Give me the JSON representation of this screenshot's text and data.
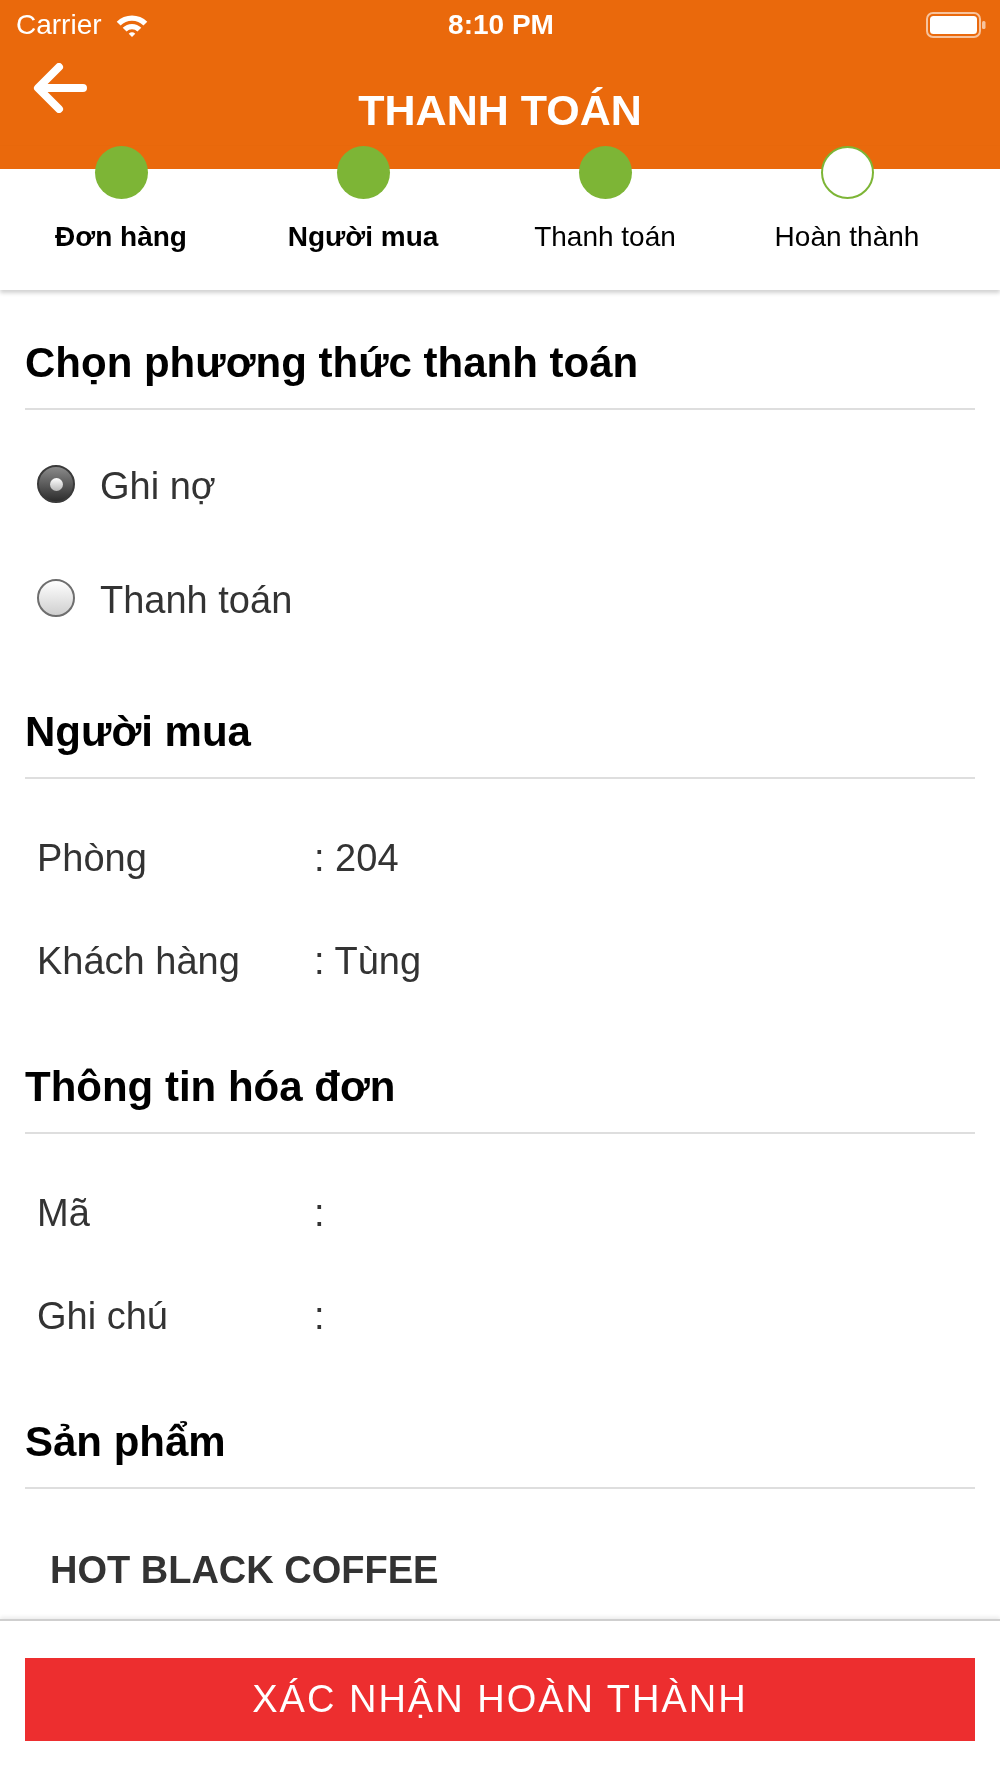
{
  "status_bar": {
    "carrier": "Carrier",
    "time": "8:10 PM"
  },
  "header": {
    "title": "THANH TOÁN"
  },
  "steps": [
    {
      "label": "Đơn hàng",
      "reached": true,
      "completed": true
    },
    {
      "label": "Người mua",
      "reached": true,
      "completed": true
    },
    {
      "label": "Thanh toán",
      "reached": true,
      "completed": false
    },
    {
      "label": "Hoàn thành",
      "reached": false,
      "completed": false
    }
  ],
  "payment_method": {
    "heading": "Chọn phương thức thanh toán",
    "options": [
      {
        "label": "Ghi nợ",
        "selected": true
      },
      {
        "label": "Thanh toán",
        "selected": false
      }
    ]
  },
  "buyer": {
    "heading": "Người mua",
    "rows": [
      {
        "label": "Phòng",
        "value": ": 204"
      },
      {
        "label": "Khách hàng",
        "value": ": Tùng"
      }
    ]
  },
  "invoice": {
    "heading": "Thông tin hóa đơn",
    "rows": [
      {
        "label": "Mã",
        "value": ":"
      },
      {
        "label": "Ghi chú",
        "value": ":"
      }
    ]
  },
  "products": {
    "heading": "Sản phẩm",
    "items": [
      {
        "name": "HOT BLACK COFFEE"
      }
    ]
  },
  "confirm_button": {
    "label": "XÁC NHẬN HOÀN THÀNH"
  }
}
